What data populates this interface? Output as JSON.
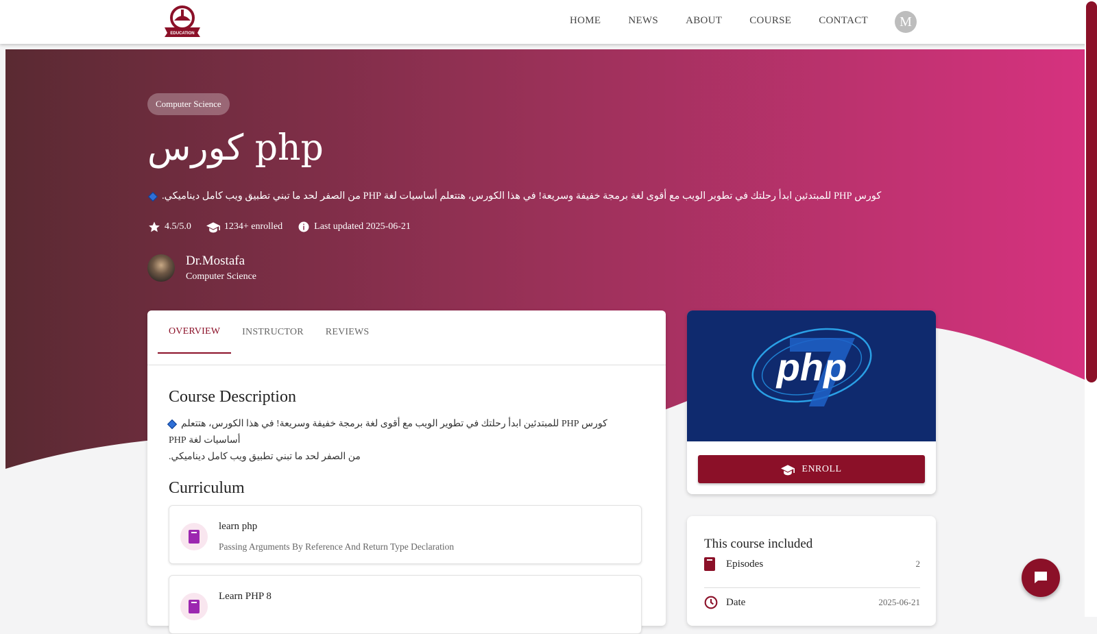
{
  "nav": {
    "logo_text": "EDUCATION",
    "items": [
      "HOME",
      "NEWS",
      "ABOUT",
      "COURSE",
      "CONTACT"
    ],
    "avatar_letter": "M"
  },
  "hero": {
    "category": "Computer Science",
    "title": "كورس php",
    "description": "كورس PHP للمبتدئين ابدأ رحلتك في تطوير الويب مع أقوى لغة برمجة خفيفة وسريعة! في هذا الكورس، هتتعلم أساسيات لغة PHP من الصفر لحد ما تبني تطبيق ويب كامل ديناميكي.",
    "rating": "4.5/5.0",
    "enrolled": "1234+ enrolled",
    "updated": "Last updated 2025-06-21",
    "instructor_name": "Dr.Mostafa",
    "instructor_sub": "Computer Science"
  },
  "tabs": [
    "OVERVIEW",
    "INSTRUCTOR",
    "REVIEWS"
  ],
  "overview": {
    "desc_heading": "Course Description",
    "desc_line1": "كورس PHP للمبتدئين ابدأ رحلتك في تطوير الويب مع أقوى لغة برمجة خفيفة وسريعة! في هذا الكورس، هتتعلم أساسيات لغة PHP",
    "desc_line2": "من الصفر لحد ما تبني تطبيق ويب كامل ديناميكي.",
    "curriculum_heading": "Curriculum",
    "lessons": [
      {
        "title": "learn php",
        "subtitle": "Passing Arguments By Reference And Return Type Declaration"
      },
      {
        "title": "Learn PHP 8",
        "subtitle": ""
      }
    ]
  },
  "side": {
    "image_text": "php",
    "enroll_label": "ENROLL",
    "included_title": "This course included",
    "rows": [
      {
        "label": "Episodes",
        "value": "2"
      },
      {
        "label": "Date",
        "value": "2025-06-21"
      }
    ]
  },
  "colors": {
    "brand": "#8b1028",
    "hero_from": "#5a2a32",
    "hero_to": "#d6327f",
    "accent_purple": "#9c27b0"
  }
}
